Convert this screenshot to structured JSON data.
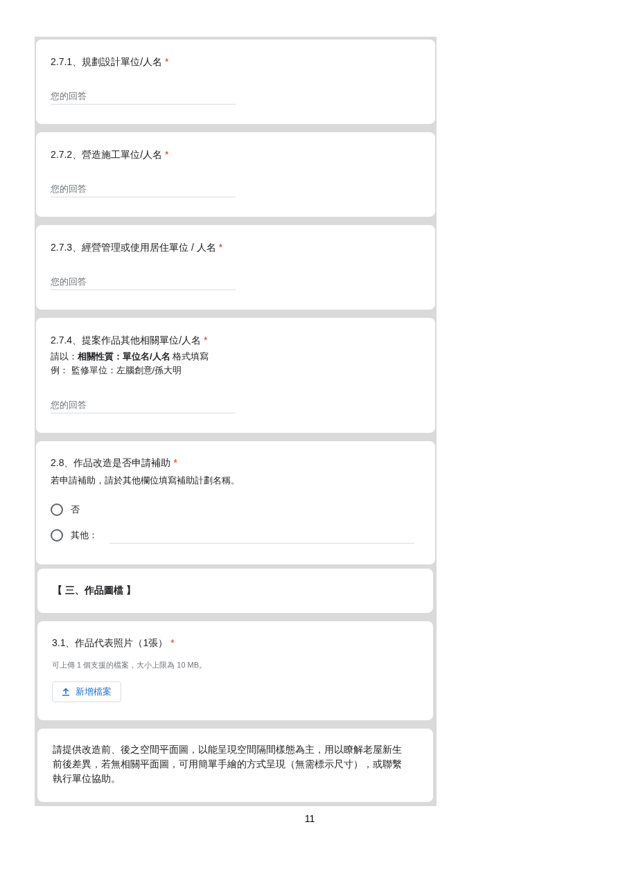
{
  "cards": [
    {
      "kind": "short_answer",
      "title": "2.7.1、規劃設計單位/人名",
      "required_mark": "*",
      "placeholder": "您的回答"
    },
    {
      "kind": "short_answer",
      "title": "2.7.2、營造施工單位/人名",
      "required_mark": "*",
      "placeholder": "您的回答"
    },
    {
      "kind": "short_answer",
      "title": "2.7.3、經營管理或使用居住單位 / 人名",
      "required_mark": "*",
      "placeholder": "您的回答"
    },
    {
      "kind": "short_answer",
      "title": "2.7.4、提案作品其他相關單位/人名",
      "required_mark": "*",
      "description": [
        "請以：**相關性質：單位名/人名** 格式填寫",
        "例： 監修單位：左腦創意/孫大明"
      ],
      "placeholder": "您的回答"
    },
    {
      "kind": "radio",
      "title": "2.8、作品改造是否申請補助",
      "required_mark": "*",
      "description": [
        "若申請補助，請於其他欄位填寫補助計劃名稱。"
      ],
      "options": [
        {
          "kind": "choice",
          "label": "否",
          "selected": false
        },
        {
          "kind": "other",
          "label": "其他：",
          "selected": false
        }
      ]
    },
    {
      "kind": "section",
      "title": "【 三、作品圖檔 】"
    },
    {
      "kind": "file_upload",
      "title": "3.1、作品代表照片（1張）",
      "required_mark": "*",
      "hint": "可上傳 1 個支援的檔案，大小上限為 10 MB。",
      "button": "新增檔案"
    },
    {
      "kind": "statement",
      "text": "請提供改造前、後之空間平面圖，以能呈現空間隔間樣態為主，用以瞭解老屋新生前後差異，若無相關平面圖，可用簡單手繪的方式呈現（無需標示尺寸），或聯繫執行單位協助。"
    }
  ],
  "page_number": "11"
}
